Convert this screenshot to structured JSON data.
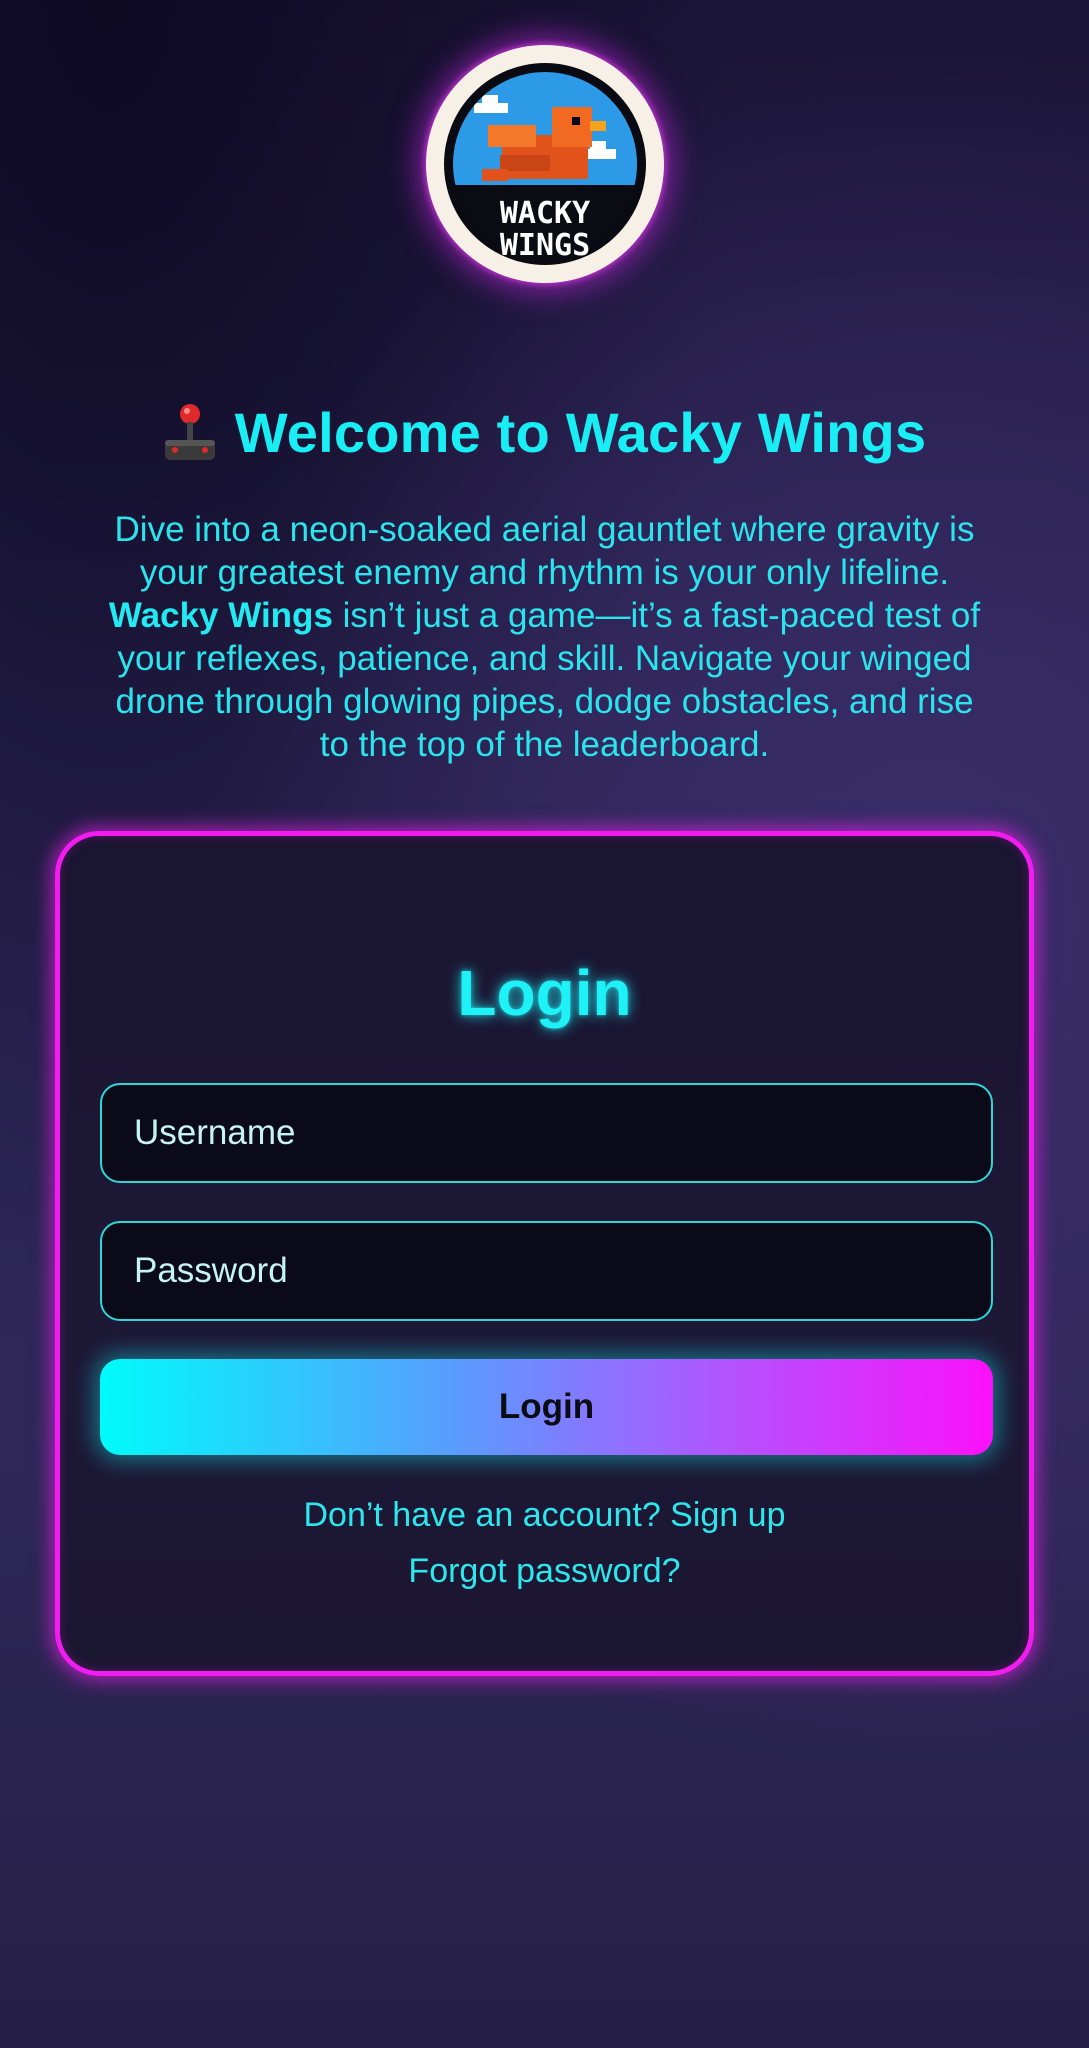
{
  "logo": {
    "text_line1": "WACKY",
    "text_line2": "WINGS",
    "icon": "bird-logo-icon"
  },
  "header": {
    "icon": "joystick-icon",
    "title": "Welcome to Wacky Wings"
  },
  "intro": {
    "line1": "Dive into a neon-soaked aerial gauntlet where gravity is",
    "line2": "your greatest enemy and rhythm is your only lifeline.",
    "brand": "Wacky Wings",
    "line3_rest": " isn’t just a game—it’s a fast-paced test of",
    "line4": "your reflexes, patience, and skill. Navigate your winged",
    "line5": "drone through glowing pipes, dodge obstacles, and rise",
    "line6": "to the top of the leaderboard."
  },
  "login_form": {
    "title": "Login",
    "username": {
      "placeholder": "Username",
      "value": ""
    },
    "password": {
      "placeholder": "Password",
      "value": ""
    },
    "submit_label": "Login",
    "signup_link": "Don’t have an account? Sign up",
    "forgot_link": "Forgot password?"
  },
  "colors": {
    "accent_cyan": "#19eef4",
    "accent_magenta": "#f21cf0",
    "card_bg": "#1b1631",
    "input_bg": "#0b0a18"
  }
}
